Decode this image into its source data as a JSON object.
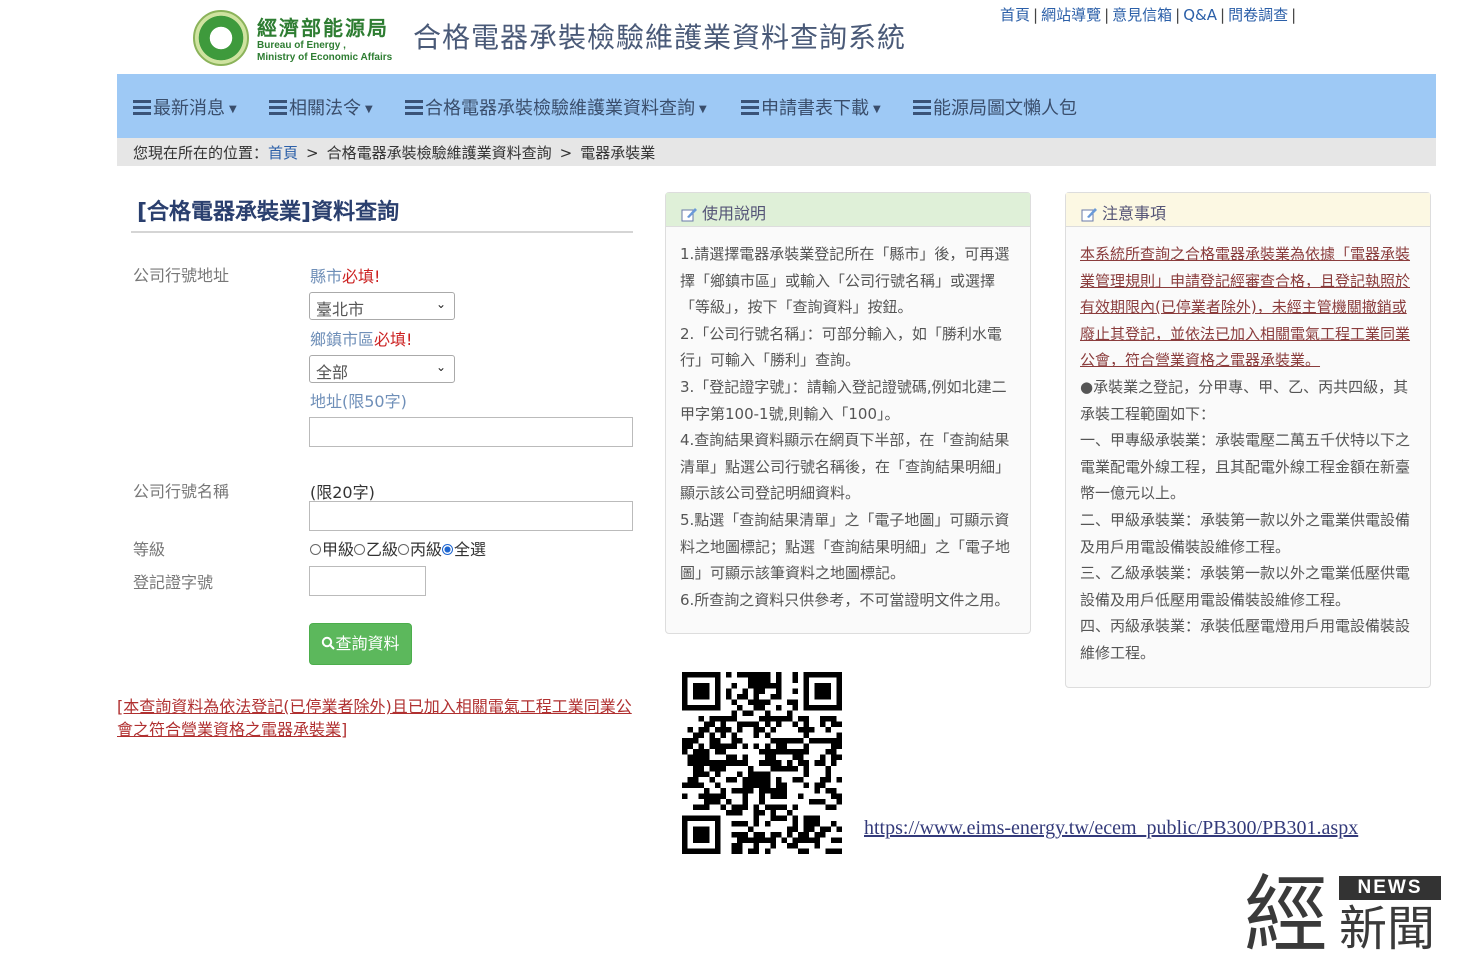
{
  "header": {
    "logo_zh": "經濟部能源局",
    "logo_en_line1": "Bureau of Energy ,",
    "logo_en_line2": "Ministry of Economic Affairs",
    "site_title": "合格電器承裝檢驗維護業資料查詢系統",
    "top_links": [
      "首頁",
      "網站導覽",
      "意見信箱",
      "Q&A",
      "問卷調查"
    ]
  },
  "nav": {
    "items": [
      "最新消息",
      "相關法令",
      "合格電器承裝檢驗維護業資料查詢",
      "申請書表下載",
      "能源局圖文懶人包"
    ]
  },
  "breadcrumb": {
    "prefix": "您現在所在的位置：",
    "home": "首頁",
    "level1": "合格電器承裝檢驗維護業資料查詢",
    "level2": "電器承裝業"
  },
  "form": {
    "title": "[合格電器承裝業]資料查詢",
    "address_label": "公司行號地址",
    "county_hint": "縣市",
    "required": "必填!",
    "county_value": "臺北市",
    "district_hint": "鄉鎮市區",
    "district_value": "全部",
    "address_hint": "地址(限50字)",
    "address_value": "",
    "name_label": "公司行號名稱",
    "name_hint": "(限20字)",
    "name_value": "",
    "grade_label": "等級",
    "grade_options": [
      "甲級",
      "乙級",
      "丙級",
      "全選"
    ],
    "grade_selected": "全選",
    "cert_label": "登記證字號",
    "cert_value": "",
    "search_button": "查詢資料",
    "note": "[本查詢資料為依法登記(已停業者除外)且已加入相關電氣工程工業同業公會之符合營業資格之電器承裝業]"
  },
  "usage": {
    "title": "使用說明",
    "lines": [
      "1.請選擇電器承裝業登記所在「縣市」後，可再選",
      "擇「鄉鎮市區」或輸入「公司行號名稱」或選擇",
      "「等級」，按下「查詢資料」按鈕。",
      "2.「公司行號名稱」：可部分輸入，如「勝利水電",
      "行」可輸入「勝利」查詢。",
      "3.「登記證字號」：請輸入登記證號碼,例如北建二",
      "甲字第100-1號,則輸入「100」。",
      "4.查詢結果資料顯示在網頁下半部，在「查詢結果",
      "清單」點選公司行號名稱後，在「查詢結果明細」",
      "顯示該公司登記明細資料。",
      "5.點選「查詢結果清單」之「電子地圖」可顯示資",
      "料之地圖標記；點選「查詢結果明細」之「電子地",
      "圖」可顯示該筆資料之地圖標記。",
      "6.所查詢之資料只供參考，不可當證明文件之用。"
    ]
  },
  "notice": {
    "title": "注意事項",
    "link_lines": [
      "本系統所查詢之合格電器承裝業為依據「電器承裝",
      "業管理規則」申請登記經審查合格，且登記執照於",
      "有效期限內(已停業者除外)，未經主管機關撤銷或",
      "廢止其登記，並依法已加入相關電氣工程工業同業",
      "公會，符合營業資格之電器承裝業。"
    ],
    "lines": [
      "●承裝業之登記，分甲專、甲、乙、丙共四級，其",
      "承裝工程範圍如下：",
      "一、甲專級承裝業：承裝電壓二萬五千伏特以下之",
      "電業配電外線工程，且其配電外線工程金額在新臺",
      "幣一億元以上。",
      "二、甲級承裝業：承裝第一款以外之電業供電設備",
      "及用戶用電設備裝設維修工程。",
      "三、乙級承裝業：承裝第一款以外之電業低壓供電",
      "設備及用戶低壓用電設備裝設維修工程。",
      "四、丙級承裝業：承裝低壓電燈用戶用電設備裝設",
      "維修工程。"
    ]
  },
  "qr": {
    "url": "https://www.eims-energy.tw/ecem_public/PB300/PB301.aspx"
  },
  "watermark": {
    "jing": "經",
    "news": "NEWS",
    "xinwen": "新聞"
  },
  "colors": {
    "nav_bg": "#9ec9f5",
    "breadcrumb_bg": "#e6e6e6",
    "button_green": "#5cb85c",
    "required_red": "#cc2222",
    "usage_head_bg": "#dff0d8",
    "notice_head_bg": "#fcf8e3"
  }
}
